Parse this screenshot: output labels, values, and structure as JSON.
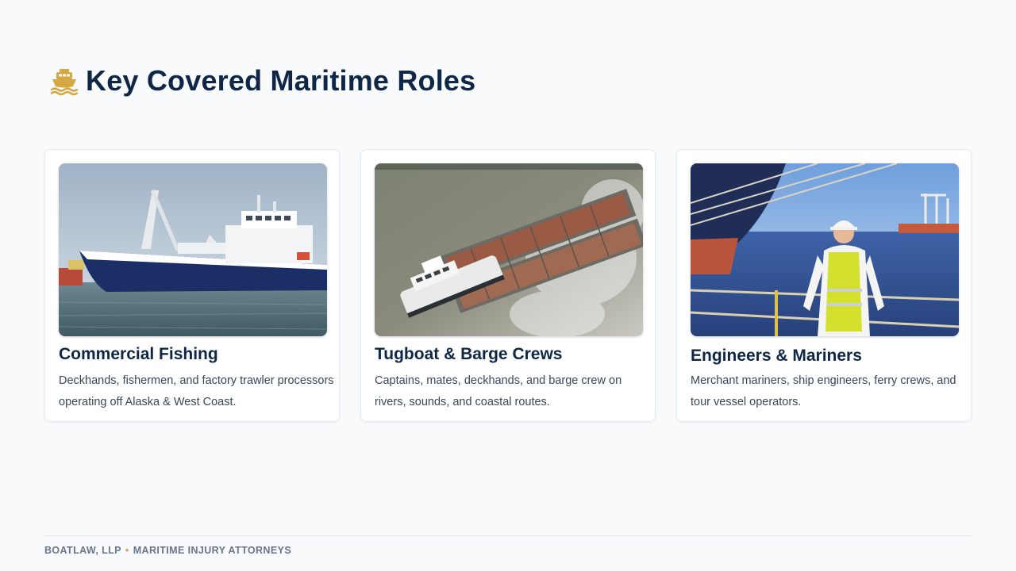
{
  "header": {
    "title": "Key Covered Maritime Roles",
    "icon": "ship-icon"
  },
  "colors": {
    "navy": "#0f2747",
    "gold": "#d4a843",
    "background": "#f8fafc",
    "body_text": "#3b4657",
    "footer_text": "#6b7587"
  },
  "cards": [
    {
      "title": "Commercial Fishing",
      "description": "Deckhands, fishermen, and factory trawler processors operating off Alaska & West Coast.",
      "image": "fishing-trawler-photo"
    },
    {
      "title": "Tugboat & Barge Crews",
      "description": "Captains, mates, deckhands, and barge crew on rivers, sounds, and coastal routes.",
      "image": "tugboat-barge-photo"
    },
    {
      "title": "Engineers & Mariners",
      "description": "Merchant mariners, ship engineers, ferry crews, and tour vessel operators.",
      "image": "mariner-worker-photo"
    }
  ],
  "footer": {
    "company": "BOATLAW, LLP",
    "separator": "•",
    "tagline": "MARITIME INJURY ATTORNEYS"
  }
}
